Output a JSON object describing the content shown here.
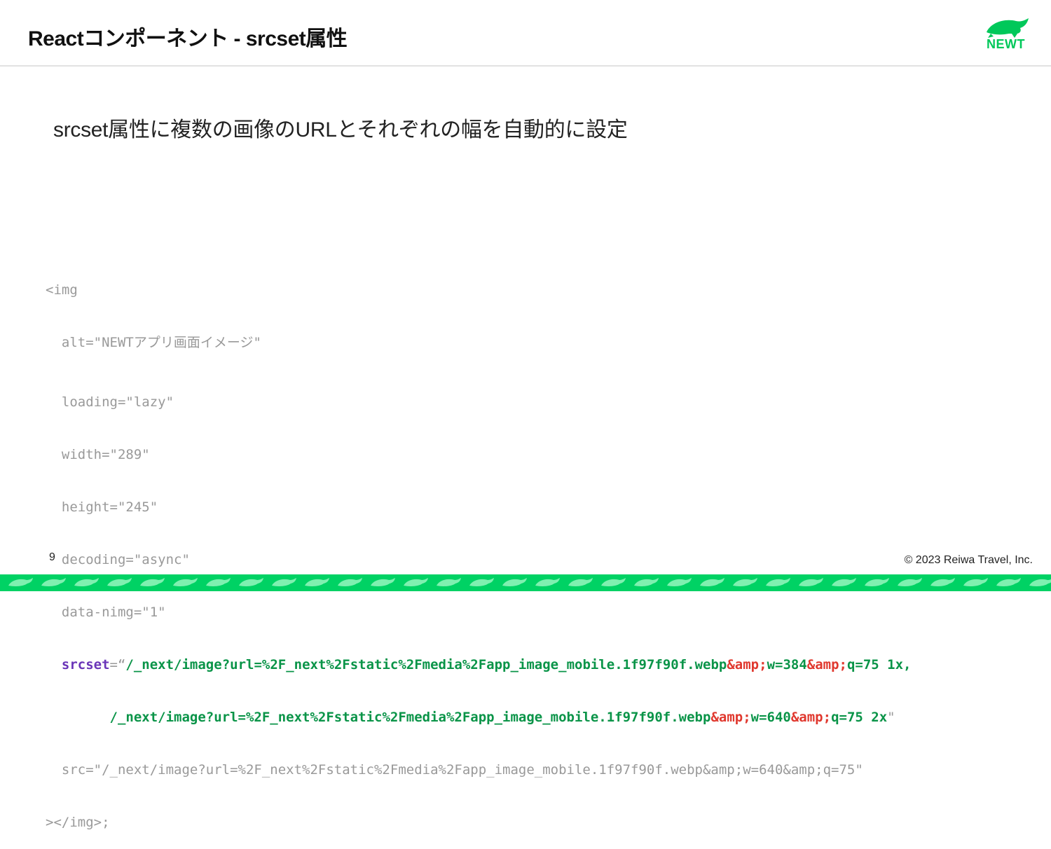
{
  "slide": {
    "title": "Reactコンポーネント - srcset属性",
    "subtitle": "srcset属性に複数の画像のURLとそれぞれの幅を自動的に設定",
    "logo_text": "NEWT",
    "page_number": "9",
    "copyright": "© 2023 Reiwa Travel, Inc.",
    "brand_color": "#00d264"
  },
  "code": {
    "line1": "<img",
    "line2": "  alt=\"NEWTアプリ画面イメージ\"",
    "line3": "  loading=\"lazy\"",
    "line4": "  width=\"289\"",
    "line5": "  height=\"245\"",
    "line6": "  decoding=\"async\"",
    "line7": "  data-nimg=\"1\"",
    "srcset": {
      "indent": "  ",
      "attr": "srcset",
      "eq": "=“",
      "path1": "/_next/image?url=%2F_next%2Fstatic%2Fmedia%2Fapp_image_mobile.1f97f90f.webp",
      "amp1": "&amp;",
      "w1": "w=384",
      "amp2": "&amp;",
      "q1": "q=75 1x,",
      "indent2": "        ",
      "path2": "/_next/image?url=%2F_next%2Fstatic%2Fmedia%2Fapp_image_mobile.1f97f90f.webp",
      "amp3": "&amp;",
      "w2": "w=640",
      "amp4": "&amp;",
      "q2": "q=75 2x",
      "close": "\""
    },
    "line10": "  src=\"/_next/image?url=%2F_next%2Fstatic%2Fmedia%2Fapp_image_mobile.1f97f90f.webp&amp;w=640&amp;q=75\"",
    "line11": "></img>;"
  }
}
